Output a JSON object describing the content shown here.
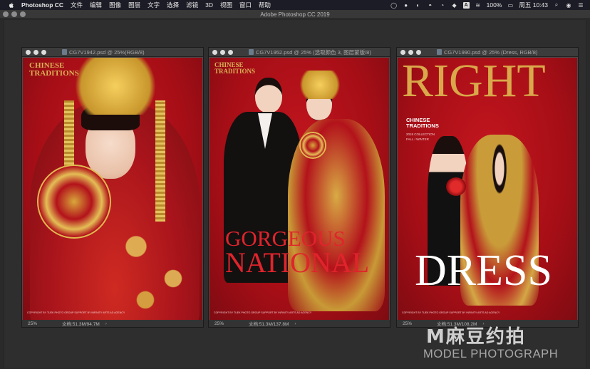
{
  "menubar": {
    "app_name": "Photoshop CC",
    "items": [
      "文件",
      "编辑",
      "图像",
      "图层",
      "文字",
      "选择",
      "滤镜",
      "3D",
      "视图",
      "窗口",
      "帮助"
    ],
    "battery": "100%",
    "datetime": "周五 10:43",
    "status_icons": [
      "circle-icon",
      "wechat-icon",
      "qq-icon",
      "ghost-icon",
      "bell-icon",
      "dropbox-icon",
      "input-a-icon",
      "wifi-icon",
      "battery-icon",
      "search-icon",
      "siri-icon",
      "list-icon"
    ]
  },
  "app_window": {
    "title": "Adobe Photoshop CC 2019"
  },
  "documents": [
    {
      "title": "CG7V1942.psd @ 25%(RGB/8)",
      "zoom": "25%",
      "doc_size": "文档:51.3M/94.7M",
      "brand_line1": "CHINESE",
      "brand_line2": "TRADITIONS",
      "fineprint": "COPYRIGHT BY TUEK PHOTO GROUP SUPPORT BY INFINITY ARTS AD AGENCY"
    },
    {
      "title": "CG7V1952.psd @ 25% (选取颜色 3, 图层蒙版/8)",
      "zoom": "25%",
      "doc_size": "文档:51.3M/137.8M",
      "brand_line1": "CHINESE",
      "brand_line2": "TRADITIONS",
      "headline1": "GORGEOUS",
      "headline2": "NATIONAL",
      "fineprint": "COPYRIGHT BY TUEK PHOTO GROUP SUPPORT BY INFINITY ARTS AD AGENCY"
    },
    {
      "title": "CG7V1990.psd @ 25% (Dress, RGB/8)",
      "zoom": "25%",
      "doc_size": "文档:51.3M/108.2M",
      "masthead": "RIGHT",
      "brand_line1": "CHINESE",
      "brand_line2": "TRADITIONS",
      "collection_line1": "2018 COLLECTION",
      "collection_line2": "FALL / WINTER",
      "headline": "DRESS",
      "fineprint": "COPYRIGHT BY TUEK PHOTO GROUP SUPPORT BY INFINITY ARTS AD AGENCY"
    }
  ],
  "watermark": {
    "logo": "M麻豆约拍",
    "text": "MODEL PHOTOGRAPH"
  },
  "colors": {
    "poster_red": "#b3121b",
    "gold": "#d9b256",
    "headline_red": "#e0242c"
  }
}
